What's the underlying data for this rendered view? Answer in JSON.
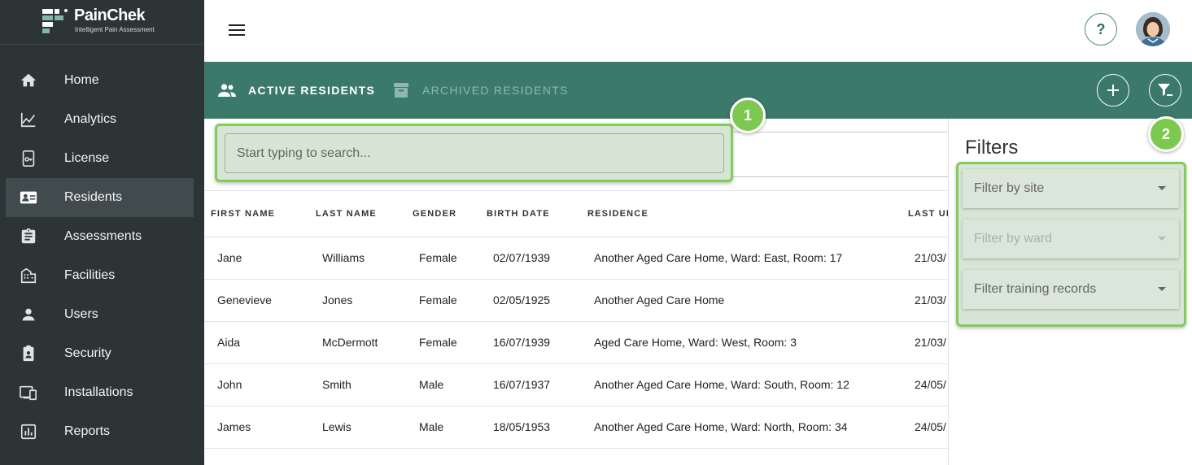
{
  "brand": {
    "name": "PainChek",
    "tagline": "Intelligent Pain Assessment"
  },
  "sidebar": {
    "items": [
      {
        "label": "Home",
        "icon": "home-icon"
      },
      {
        "label": "Analytics",
        "icon": "analytics-icon"
      },
      {
        "label": "License",
        "icon": "license-icon"
      },
      {
        "label": "Residents",
        "icon": "residents-icon",
        "active": true
      },
      {
        "label": "Assessments",
        "icon": "assessments-icon"
      },
      {
        "label": "Facilities",
        "icon": "facilities-icon"
      },
      {
        "label": "Users",
        "icon": "users-icon"
      },
      {
        "label": "Security",
        "icon": "security-icon"
      },
      {
        "label": "Installations",
        "icon": "installations-icon"
      },
      {
        "label": "Reports",
        "icon": "reports-icon"
      }
    ]
  },
  "header": {
    "help_label": "?"
  },
  "tabs": {
    "active_label": "ACTIVE RESIDENTS",
    "archived_label": "ARCHIVED RESIDENTS"
  },
  "search": {
    "placeholder": "Start typing to search..."
  },
  "table": {
    "headers": [
      "FIRST NAME",
      "LAST NAME",
      "GENDER",
      "BIRTH DATE",
      "RESIDENCE",
      "LAST UP"
    ],
    "rows": [
      [
        "Jane",
        "Williams",
        "Female",
        "02/07/1939",
        "Another Aged Care Home, Ward: East, Room: 17",
        "21/03/"
      ],
      [
        "Genevieve",
        "Jones",
        "Female",
        "02/05/1925",
        "Another Aged Care Home",
        "21/03/"
      ],
      [
        "Aida",
        "McDermott",
        "Female",
        "16/07/1939",
        "Aged Care Home, Ward: West, Room: 3",
        "21/03/"
      ],
      [
        "John",
        "Smith",
        "Male",
        "16/07/1937",
        "Another Aged Care Home, Ward: South, Room: 12",
        "24/05/"
      ],
      [
        "James",
        "Lewis",
        "Male",
        "18/05/1953",
        "Another Aged Care Home, Ward: North, Room: 34",
        "24/05/"
      ]
    ]
  },
  "filters": {
    "title": "Filters",
    "site_label": "Filter by site",
    "ward_label": "Filter by ward",
    "training_label": "Filter training records"
  },
  "badges": {
    "one": "1",
    "two": "2"
  },
  "colors": {
    "sidebar": "#2c3436",
    "accent": "#3b7a6b",
    "highlight": "#82cc5a"
  }
}
